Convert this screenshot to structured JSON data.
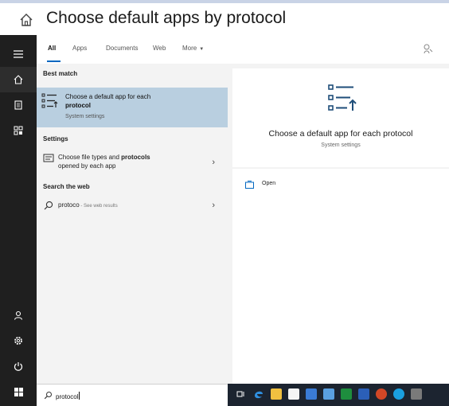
{
  "window": {
    "title": "Choose default apps by protocol",
    "home_icon": "home-icon"
  },
  "rail": {
    "icons": [
      "menu-icon",
      "home-icon",
      "document-icon",
      "apps-icon",
      "person-icon",
      "settings-icon",
      "power-icon",
      "windows-icon"
    ]
  },
  "tabs": {
    "items": [
      "All",
      "Apps",
      "Documents",
      "Web",
      "More"
    ],
    "active": "All"
  },
  "sections": {
    "best_match": "Best match",
    "settings": "Settings",
    "search_web": "Search the web"
  },
  "best_match": {
    "title_pre": "Choose a default app for each",
    "title_bold": "protocol",
    "subtitle": "System settings"
  },
  "settings_item": {
    "text_pre": "Choose file types and",
    "text_bold": "protocols",
    "text_post": "opened by each app"
  },
  "web_item": {
    "query": "protoco",
    "suffix": " - See web results"
  },
  "preview": {
    "title": "Choose a default app for each protocol",
    "subtitle": "System settings"
  },
  "actions": {
    "open_label": "Open"
  },
  "search": {
    "value": "protocol"
  },
  "colors": {
    "accent": "#0067c0",
    "selected": "#b9cfe0",
    "rail": "#1f1f1f",
    "taskbar": "#1c2430"
  }
}
